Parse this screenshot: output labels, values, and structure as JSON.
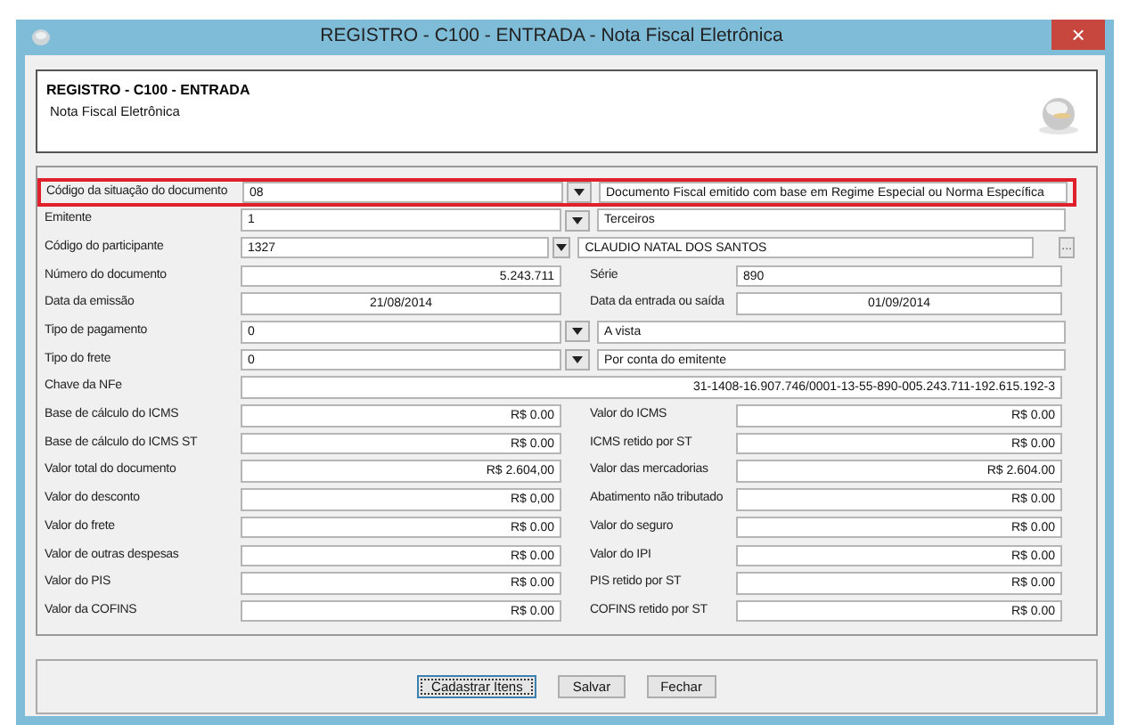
{
  "window": {
    "title": "REGISTRO - C100 - ENTRADA - Nota Fiscal Eletrônica",
    "close": "×"
  },
  "header": {
    "title": "REGISTRO - C100 - ENTRADA",
    "subtitle": "Nota Fiscal Eletrônica"
  },
  "rows": [
    {
      "kind": "combo",
      "label": "Código da situação do documento",
      "value": "08",
      "description": "Documento Fiscal emitido com base em Regime Especial ou Norma Específica",
      "highlighted": true,
      "lookup": false
    },
    {
      "kind": "combo",
      "label": "Emitente",
      "value": "1",
      "description": "Terceiros",
      "highlighted": false,
      "lookup": false
    },
    {
      "kind": "combo",
      "label": "Código do participante",
      "value": "1327",
      "description": "CLAUDIO NATAL DOS SANTOS",
      "highlighted": false,
      "lookup": true,
      "lookup_label": "..."
    },
    {
      "kind": "pair",
      "left": {
        "label": "Número do documento",
        "value": "5.243.711",
        "kind": "number"
      },
      "right": {
        "label": "Série",
        "value": "890",
        "kind": "text"
      }
    },
    {
      "kind": "pair",
      "left": {
        "label": "Data da emissão",
        "value": "21/08/2014",
        "kind": "date"
      },
      "right": {
        "label": "Data da entrada ou saída",
        "value": "01/09/2014",
        "kind": "date"
      }
    },
    {
      "kind": "combo",
      "label": "Tipo de pagamento",
      "value": "0",
      "description": "A vista",
      "highlighted": false,
      "lookup": false
    },
    {
      "kind": "combo",
      "label": "Tipo do frete",
      "value": "0",
      "description": "Por conta do emitente",
      "highlighted": false,
      "lookup": false
    },
    {
      "kind": "wide",
      "label": "Chave da NFe",
      "value": "31-1408-16.907.746/0001-13-55-890-005.243.711-192.615.192-3"
    },
    {
      "kind": "pair",
      "left": {
        "label": "Base de cálculo do ICMS",
        "value": "R$ 0.00",
        "kind": "number"
      },
      "right": {
        "label": "Valor do ICMS",
        "value": "R$ 0.00",
        "kind": "number"
      }
    },
    {
      "kind": "pair",
      "left": {
        "label": "Base de cálculo do ICMS ST",
        "value": "R$ 0.00",
        "kind": "number"
      },
      "right": {
        "label": "ICMS retido por ST",
        "value": "R$ 0.00",
        "kind": "number"
      }
    },
    {
      "kind": "pair",
      "left": {
        "label": "Valor total do documento",
        "value": "R$ 2.604,00",
        "kind": "number"
      },
      "right": {
        "label": "Valor das mercadorias",
        "value": "R$ 2.604.00",
        "kind": "number"
      }
    },
    {
      "kind": "pair",
      "left": {
        "label": "Valor do desconto",
        "value": "R$ 0,00",
        "kind": "number"
      },
      "right": {
        "label": "Abatimento não tributado",
        "value": "R$ 0.00",
        "kind": "number"
      }
    },
    {
      "kind": "pair",
      "left": {
        "label": "Valor do frete",
        "value": "R$ 0.00",
        "kind": "number"
      },
      "right": {
        "label": "Valor do seguro",
        "value": "R$ 0.00",
        "kind": "number"
      }
    },
    {
      "kind": "pair",
      "left": {
        "label": "Valor de outras despesas",
        "value": "R$ 0.00",
        "kind": "number"
      },
      "right": {
        "label": "Valor do IPI",
        "value": "R$ 0.00",
        "kind": "number"
      }
    },
    {
      "kind": "pair",
      "left": {
        "label": "Valor do PIS",
        "value": "R$ 0.00",
        "kind": "number"
      },
      "right": {
        "label": "PIS retido por ST",
        "value": "R$ 0.00",
        "kind": "number"
      }
    },
    {
      "kind": "pair",
      "left": {
        "label": "Valor da COFINS",
        "value": "R$ 0.00",
        "kind": "number"
      },
      "right": {
        "label": "COFINS retido por ST",
        "value": "R$ 0.00",
        "kind": "number"
      }
    }
  ],
  "buttons": [
    {
      "label": "Cadastrar Itens",
      "focused": true
    },
    {
      "label": "Salvar",
      "focused": false
    },
    {
      "label": "Fechar",
      "focused": false
    }
  ]
}
